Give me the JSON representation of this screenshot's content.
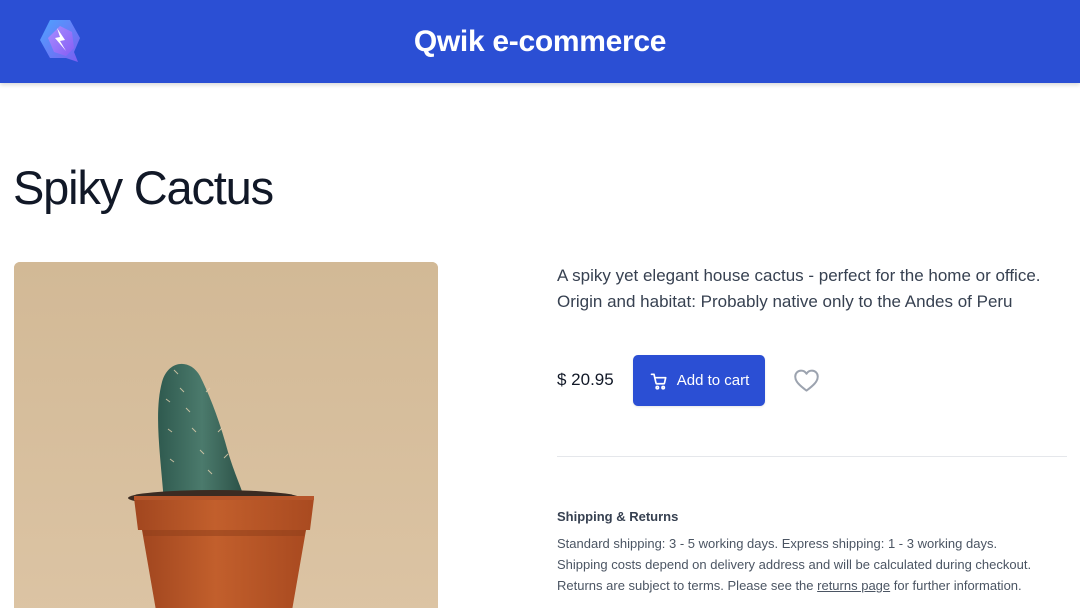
{
  "header": {
    "title": "Qwik e-commerce",
    "logo_icon": "qwik-logo-icon",
    "brand_color": "#2b4fd4"
  },
  "product": {
    "title": "Spiky Cactus",
    "image_icon": "cactus-photo",
    "description_lines": [
      "A spiky yet elegant house cactus - perfect for the home or office.",
      "Origin and habitat: Probably native only to the Andes of Peru"
    ],
    "price": "$ 20.95",
    "add_to_cart_label": "Add to cart",
    "cart_icon": "shopping-cart-icon",
    "wishlist_icon": "heart-icon"
  },
  "shipping": {
    "title": "Shipping & Returns",
    "line1": "Standard shipping: 3 - 5 working days. Express shipping: 1 - 3 working days.",
    "line2": "Shipping costs depend on delivery address and will be calculated during checkout.",
    "line3_pre": "Returns are subject to terms. Please see the ",
    "line3_link": "returns page",
    "line3_post": " for further information."
  }
}
